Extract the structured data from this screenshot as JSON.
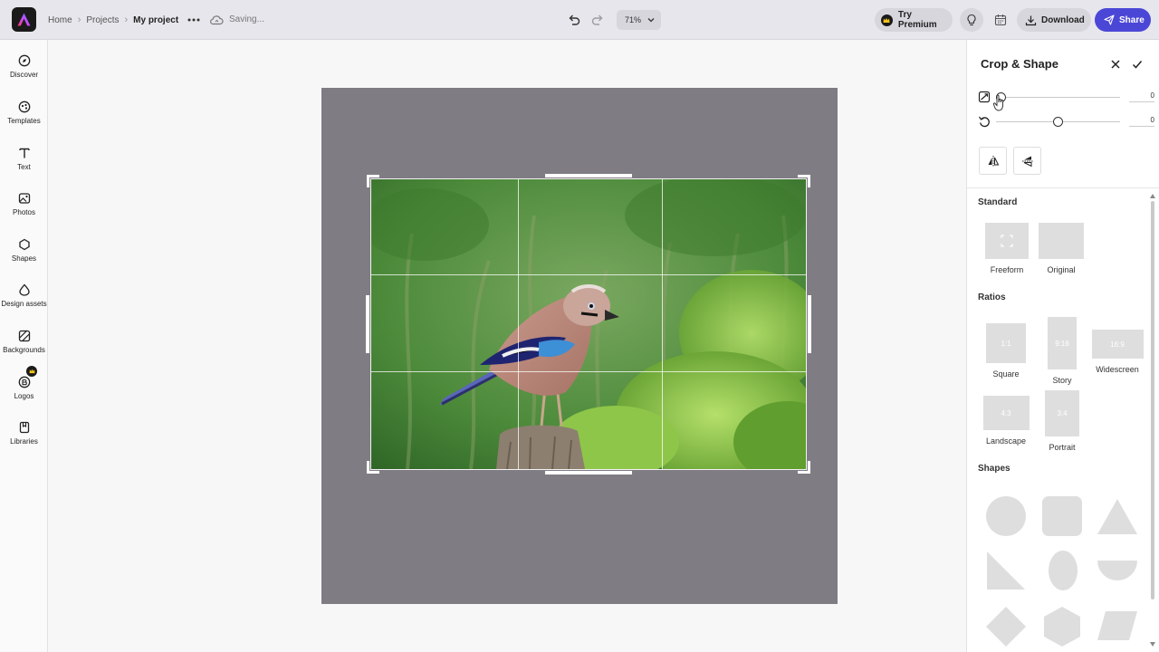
{
  "topbar": {
    "breadcrumbs": [
      "Home",
      "Projects",
      "My project"
    ],
    "status": "Saving...",
    "zoom": "71%",
    "premium_label": "Try Premium",
    "download_label": "Download",
    "share_label": "Share"
  },
  "rail": {
    "items": [
      {
        "label": "Discover",
        "icon": "compass-icon"
      },
      {
        "label": "Templates",
        "icon": "templates-icon"
      },
      {
        "label": "Text",
        "icon": "text-icon"
      },
      {
        "label": "Photos",
        "icon": "photo-icon"
      },
      {
        "label": "Shapes",
        "icon": "shapes-icon"
      },
      {
        "label": "Design assets",
        "icon": "design-assets-icon"
      },
      {
        "label": "Backgrounds",
        "icon": "backgrounds-icon"
      },
      {
        "label": "Logos",
        "icon": "logos-icon"
      },
      {
        "label": "Libraries",
        "icon": "libraries-icon"
      }
    ]
  },
  "panel": {
    "title": "Crop & Shape",
    "straighten_value": "0",
    "rotate_value": "0",
    "sections": {
      "standard": "Standard",
      "ratios": "Ratios",
      "shapes": "Shapes"
    },
    "standard_options": [
      "Freeform",
      "Original"
    ],
    "ratio_options": [
      {
        "ratio": "1:1",
        "label": "Square"
      },
      {
        "ratio": "9:16",
        "label": "Story"
      },
      {
        "ratio": "16:9",
        "label": "Widescreen"
      },
      {
        "ratio": "4:3",
        "label": "Landscape"
      },
      {
        "ratio": "3:4",
        "label": "Portrait"
      }
    ]
  },
  "colors": {
    "accent": "#4b47d6",
    "artboard": "#807c84",
    "topbar": "#e6e6ec"
  }
}
